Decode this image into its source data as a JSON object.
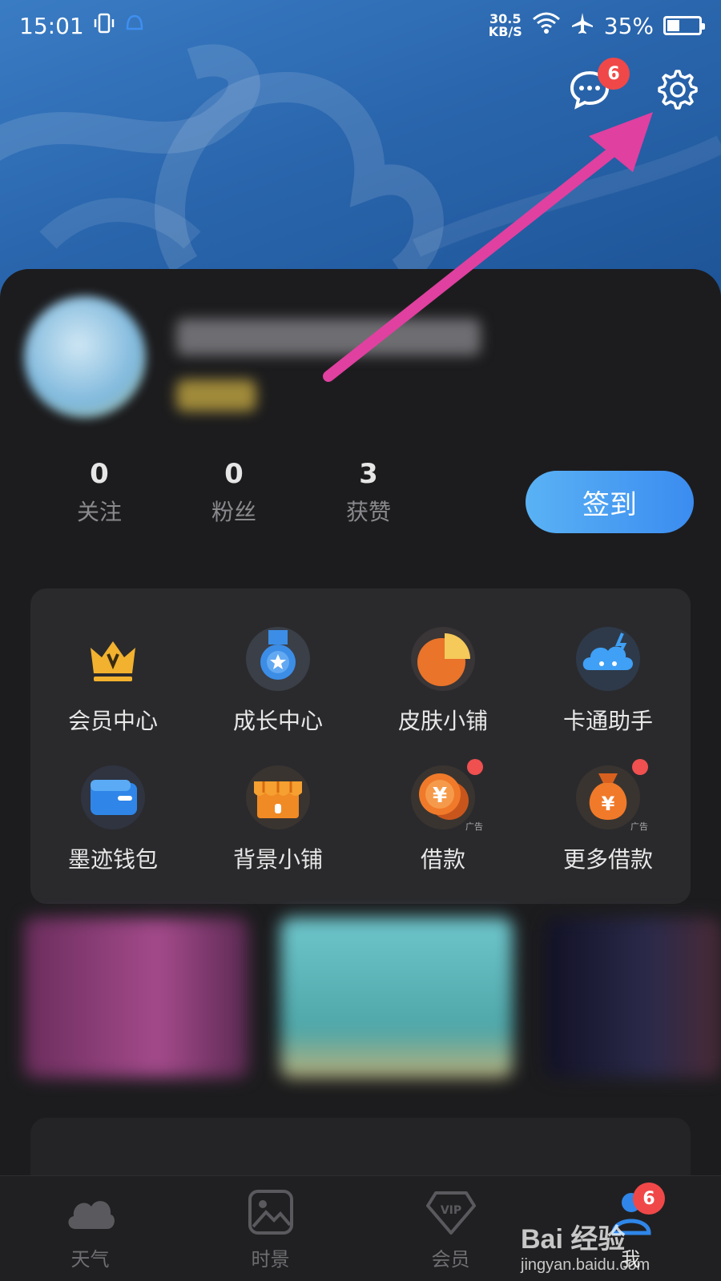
{
  "status_bar": {
    "time": "15:01",
    "net_speed_value": "30.5",
    "net_speed_unit": "KB/S",
    "battery": "35%",
    "battery_level": 0.35
  },
  "header": {
    "messages_badge": "6"
  },
  "stats": [
    {
      "value": "0",
      "label": "关注"
    },
    {
      "value": "0",
      "label": "粉丝"
    },
    {
      "value": "3",
      "label": "获赞"
    }
  ],
  "checkin_label": "签到",
  "grid": [
    {
      "label": "会员中心",
      "icon": "crown-icon"
    },
    {
      "label": "成长中心",
      "icon": "medal-icon"
    },
    {
      "label": "皮肤小铺",
      "icon": "pie-icon"
    },
    {
      "label": "卡通助手",
      "icon": "cartoon-cloud-icon"
    },
    {
      "label": "墨迹钱包",
      "icon": "wallet-icon"
    },
    {
      "label": "背景小铺",
      "icon": "shop-icon"
    },
    {
      "label": "借款",
      "icon": "coin-icon",
      "ad": "广告"
    },
    {
      "label": "更多借款",
      "icon": "money-bag-icon",
      "ad": "广告"
    }
  ],
  "tabs": [
    {
      "label": "天气",
      "icon": "cloud-icon"
    },
    {
      "label": "时景",
      "icon": "photo-icon"
    },
    {
      "label": "会员",
      "icon": "vip-diamond-icon"
    },
    {
      "label": "我",
      "icon": "user-icon",
      "badge": "6"
    }
  ],
  "watermark": {
    "brand": "Bai 经验",
    "url": "jingyan.baidu.com"
  },
  "colors": {
    "header_blue": "#2a66ad",
    "arrow_pink": "#e040a0",
    "badge_red": "#f04848",
    "checkin_blue": "#3b8cf0"
  }
}
